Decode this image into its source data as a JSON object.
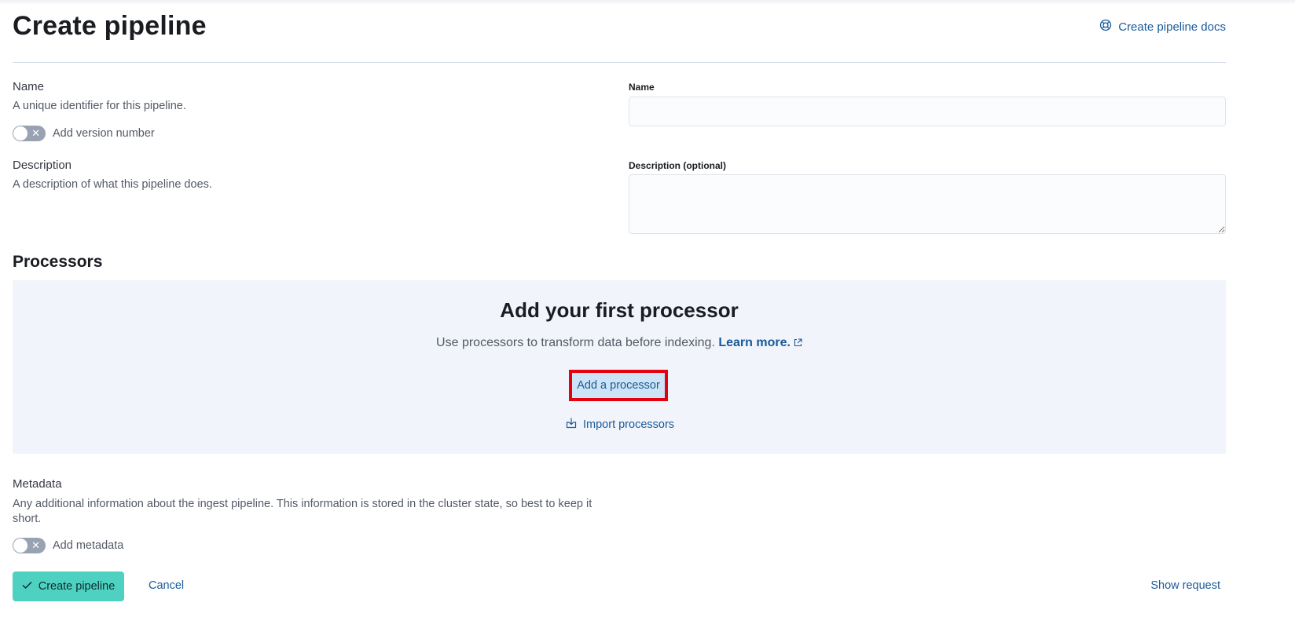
{
  "header": {
    "title": "Create pipeline",
    "docs_link": "Create pipeline docs"
  },
  "name_section": {
    "title": "Name",
    "description": "A unique identifier for this pipeline.",
    "version_toggle_label": "Add version number",
    "version_toggle_on": false,
    "field_label": "Name",
    "field_value": ""
  },
  "description_section": {
    "title": "Description",
    "description": "A description of what this pipeline does.",
    "field_label": "Description (optional)",
    "field_value": ""
  },
  "processors": {
    "title": "Processors",
    "empty_title": "Add your first processor",
    "empty_body": "Use processors to transform data before indexing.",
    "learn_more": "Learn more.",
    "add_button": "Add a processor",
    "import_link": "Import processors"
  },
  "metadata_section": {
    "title": "Metadata",
    "description": "Any additional information about the ingest pipeline. This information is stored in the cluster state, so best to keep it short.",
    "toggle_label": "Add metadata",
    "toggle_on": false
  },
  "footer": {
    "create_button": "Create pipeline",
    "cancel": "Cancel",
    "show_request": "Show request"
  },
  "colors": {
    "link": "#1a5a9a",
    "primary_button": "#4fd1c1",
    "highlight_border": "#e4000f",
    "empty_panel": "#f1f4fa"
  }
}
